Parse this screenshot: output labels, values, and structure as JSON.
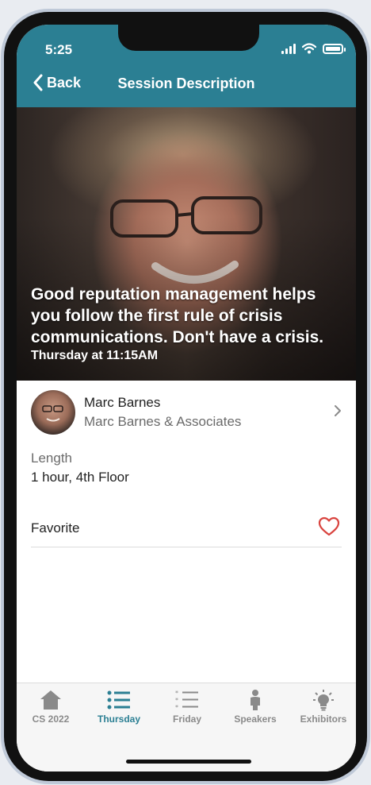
{
  "status": {
    "time": "5:25"
  },
  "nav": {
    "back_label": "Back",
    "title": "Session Description"
  },
  "session": {
    "title": "Good reputation management helps you follow the first rule of crisis communications. Don't have a crisis.",
    "time": "Thursday at 11:15AM",
    "length_label": "Length",
    "length_value": "1 hour, 4th Floor",
    "favorite_label": "Favorite"
  },
  "speaker": {
    "name": "Marc Barnes",
    "organization": "Marc Barnes & Associates"
  },
  "tabs": [
    {
      "label": "CS 2022",
      "icon": "home-icon"
    },
    {
      "label": "Thursday",
      "icon": "list-icon",
      "active": true
    },
    {
      "label": "Friday",
      "icon": "numbered-list-icon"
    },
    {
      "label": "Speakers",
      "icon": "person-icon"
    },
    {
      "label": "Exhibitors",
      "icon": "lightbulb-icon"
    }
  ],
  "colors": {
    "accent": "#2b7f93",
    "heart": "#d9443f",
    "inactive": "#8a8a8a"
  }
}
